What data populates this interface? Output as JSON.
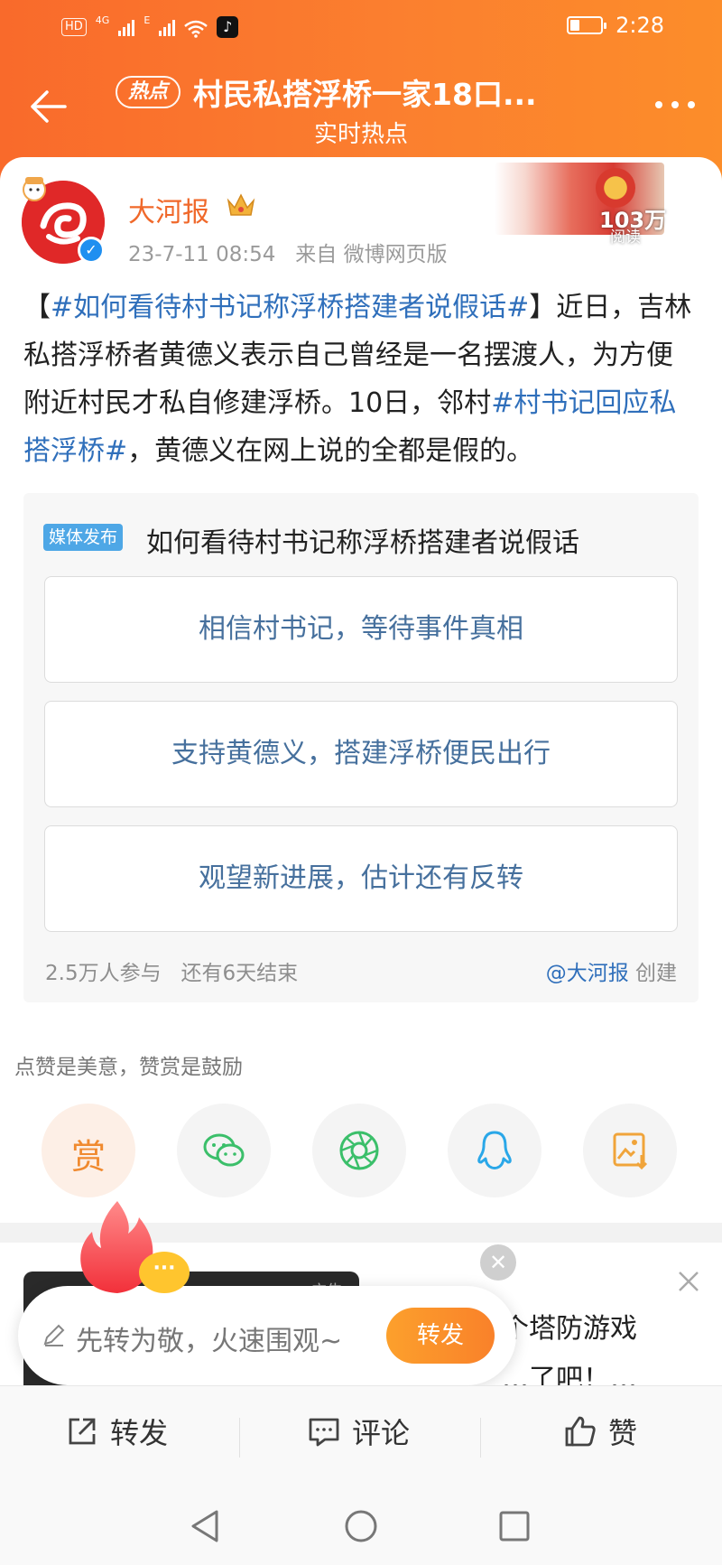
{
  "status_bar": {
    "hd": "HD",
    "net1": "4G",
    "net2": "E",
    "time": "2:28"
  },
  "header": {
    "hot_tag": "热点",
    "title": "村民私搭浮桥一家18口...",
    "subtitle": "实时热点"
  },
  "post": {
    "author": "大河报",
    "date": "23-7-11 08:54",
    "source": "来自 微博网页版",
    "reads_count": "103万",
    "reads_label": "阅读",
    "text": {
      "topic1": "#如何看待村书记称浮桥搭建者说假话#",
      "bracket_open": "【",
      "bracket_close": "】",
      "part1": "近日，吉林私搭浮桥者黄德义表示自己曾经是一名摆渡人，为方便附近村民才私自修建浮桥。10日，邻村",
      "topic2": "#村书记回应私搭浮桥#",
      "part2": "，黄德义在网上说的全都是假的。"
    }
  },
  "poll": {
    "tag": "媒体发布",
    "title": "如何看待村书记称浮桥搭建者说假话",
    "options": [
      "相信村书记，等待事件真相",
      "支持黄德义，搭建浮桥便民出行",
      "观望新进展，估计还有反转"
    ],
    "participants": "2.5万人参与",
    "remaining": "还有6天结束",
    "creator": "@大河报",
    "created_label": "创建"
  },
  "tip": "点赞是美意，赞赏是鼓励",
  "share": {
    "reward_label": "赏",
    "icons": [
      "wechat-icon",
      "moments-icon",
      "qq-icon",
      "save-image-icon"
    ]
  },
  "ad": {
    "thumb_label": "广告",
    "text_line1": "个塔防游戏",
    "text_line2": "…了吧！…"
  },
  "repost_bubble": {
    "placeholder": "先转为敬，火速围观~",
    "send_label": "转发",
    "dots": "···"
  },
  "actions": {
    "repost": "转发",
    "comment": "评论",
    "like": "赞"
  },
  "colors": {
    "header_orange": "#f96a2b",
    "author_orange": "#f0682a",
    "topic_blue": "#2f6fbb",
    "poll_text": "#46709d"
  }
}
